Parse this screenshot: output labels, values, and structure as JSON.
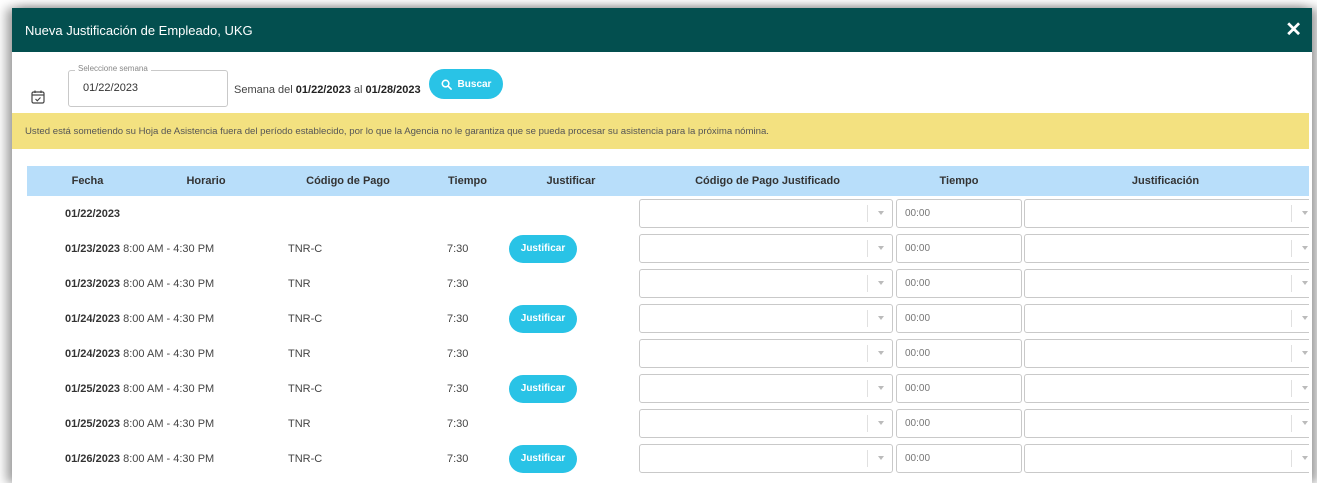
{
  "modal": {
    "title": "Nueva Justificación de Empleado, UKG",
    "close_label": "✕"
  },
  "filter": {
    "week_label": "Seleccione semana",
    "week_value": "01/22/2023",
    "week_text_prefix": "Semana del",
    "week_start": "01/22/2023",
    "week_text_mid": "al",
    "week_end": "01/28/2023",
    "search_label": "Buscar"
  },
  "warning": {
    "text": "Usted está sometiendo su Hoja de Asistencia fuera del período establecido, por lo que la Agencia no le garantiza que se pueda procesar su asistencia para la próxima nómina."
  },
  "table": {
    "headers": [
      "Fecha",
      "Horario",
      "Código de Pago",
      "Tiempo",
      "Justificar",
      "Código de Pago Justificado",
      "Tiempo",
      "Justificación"
    ],
    "justify_label": "Justificar",
    "time_placeholder": "00:00",
    "rows": [
      {
        "date": "01/22/2023",
        "schedule": "",
        "code": "",
        "time": ""
      },
      {
        "date": "01/23/2023",
        "schedule": "8:00 AM - 4:30 PM",
        "code": "TNR-C",
        "time": "7:30"
      },
      {
        "date": "01/23/2023",
        "schedule": "8:00 AM - 4:30 PM",
        "code": "TNR",
        "time": "7:30"
      },
      {
        "date": "01/24/2023",
        "schedule": "8:00 AM - 4:30 PM",
        "code": "TNR-C",
        "time": "7:30"
      },
      {
        "date": "01/24/2023",
        "schedule": "8:00 AM - 4:30 PM",
        "code": "TNR",
        "time": "7:30"
      },
      {
        "date": "01/25/2023",
        "schedule": "8:00 AM - 4:30 PM",
        "code": "TNR-C",
        "time": "7:30"
      },
      {
        "date": "01/25/2023",
        "schedule": "8:00 AM - 4:30 PM",
        "code": "TNR",
        "time": "7:30"
      },
      {
        "date": "01/26/2023",
        "schedule": "8:00 AM - 4:30 PM",
        "code": "TNR-C",
        "time": "7:30"
      }
    ]
  },
  "colors": {
    "header_bg": "#034f4f",
    "accent": "#29c3e6",
    "warning_bg": "#f3e180",
    "table_header_bg": "#b8defa"
  },
  "icons": {
    "calendar": "calendar-icon",
    "search": "search-icon",
    "close": "close-icon",
    "dropdown": "chevron-down-icon"
  }
}
